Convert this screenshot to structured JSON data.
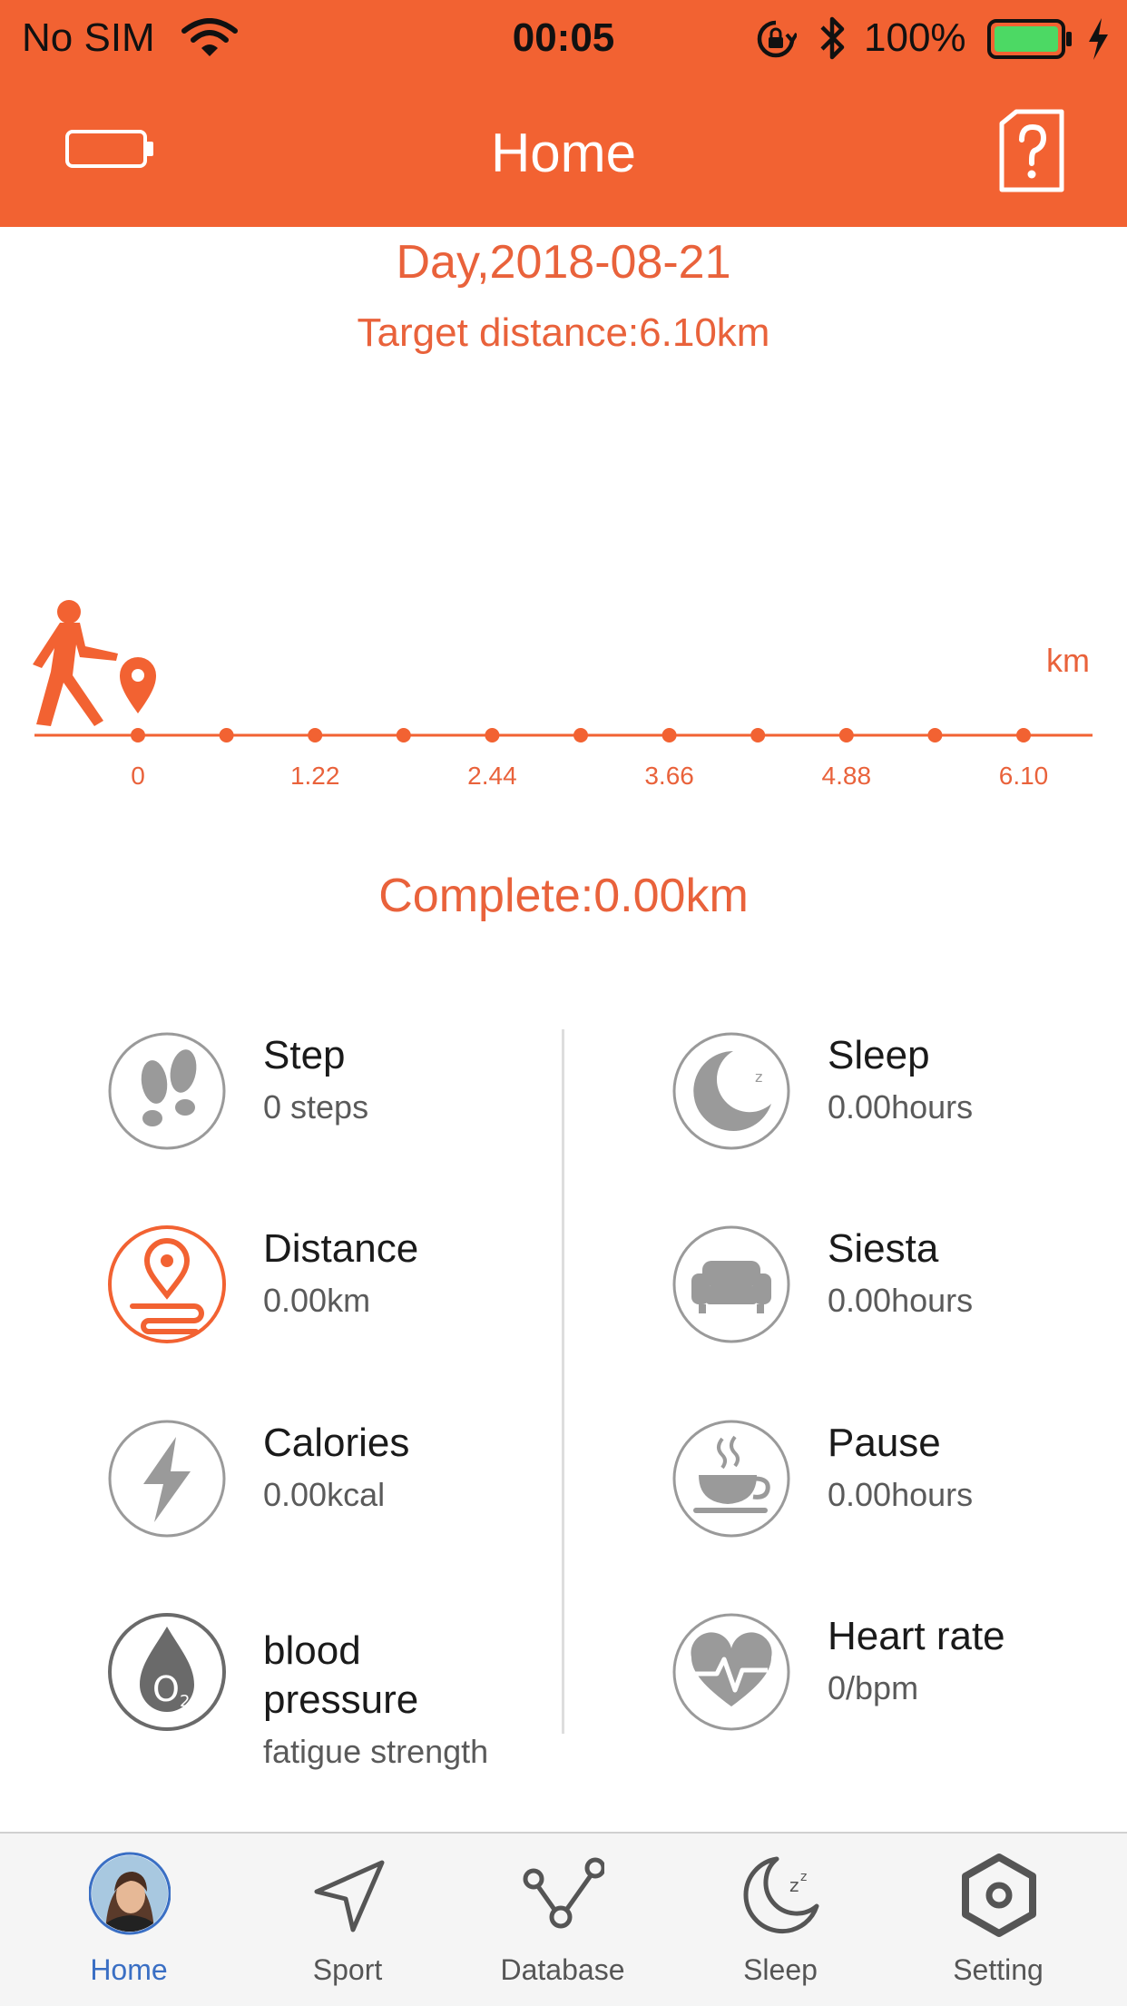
{
  "status_bar": {
    "carrier": "No SIM",
    "time": "00:05",
    "battery_percent": "100%"
  },
  "header": {
    "title": "Home",
    "left_icon": "battery-outline-icon",
    "right_icon": "help-document-icon"
  },
  "summary": {
    "date": "Day,2018-08-21",
    "target": "Target distance:6.10km",
    "complete": "Complete:0.00km"
  },
  "chart_data": {
    "type": "line",
    "unit_label": "km",
    "tick_labels": [
      "0",
      "1.22",
      "2.44",
      "3.66",
      "4.88",
      "6.10"
    ],
    "xlim": [
      0,
      6.1
    ],
    "progress_km": 0.0,
    "color": "#f26232"
  },
  "metrics": {
    "step": {
      "label": "Step",
      "value": "0 steps",
      "icon": "footprints-icon"
    },
    "sleep": {
      "label": "Sleep",
      "value": "0.00hours",
      "icon": "moon-icon"
    },
    "distance": {
      "label": "Distance",
      "value": "0.00km",
      "icon": "location-pin-icon"
    },
    "siesta": {
      "label": "Siesta",
      "value": "0.00hours",
      "icon": "sofa-icon"
    },
    "calories": {
      "label": "Calories",
      "value": "0.00kcal",
      "icon": "lightning-icon"
    },
    "pause": {
      "label": "Pause",
      "value": "0.00hours",
      "icon": "coffee-cup-icon"
    },
    "blood": {
      "label_line1": "blood",
      "label_line2": "pressure",
      "value": "fatigue strength",
      "icon": "oxygen-drop-icon"
    },
    "heart": {
      "label": "Heart rate",
      "value": "0/bpm",
      "icon": "heart-pulse-icon"
    }
  },
  "tabs": [
    {
      "label": "Home",
      "icon": "avatar",
      "active": true
    },
    {
      "label": "Sport",
      "icon": "navigation-arrow-icon",
      "active": false
    },
    {
      "label": "Database",
      "icon": "nodes-graph-icon",
      "active": false
    },
    {
      "label": "Sleep",
      "icon": "moon-icon",
      "active": false
    },
    {
      "label": "Setting",
      "icon": "hexagon-gear-icon",
      "active": false
    }
  ],
  "colors": {
    "accent": "#f26232",
    "text_accent": "#e9623b",
    "tab_active": "#3a6fc4",
    "battery_fill": "#4cd964"
  }
}
